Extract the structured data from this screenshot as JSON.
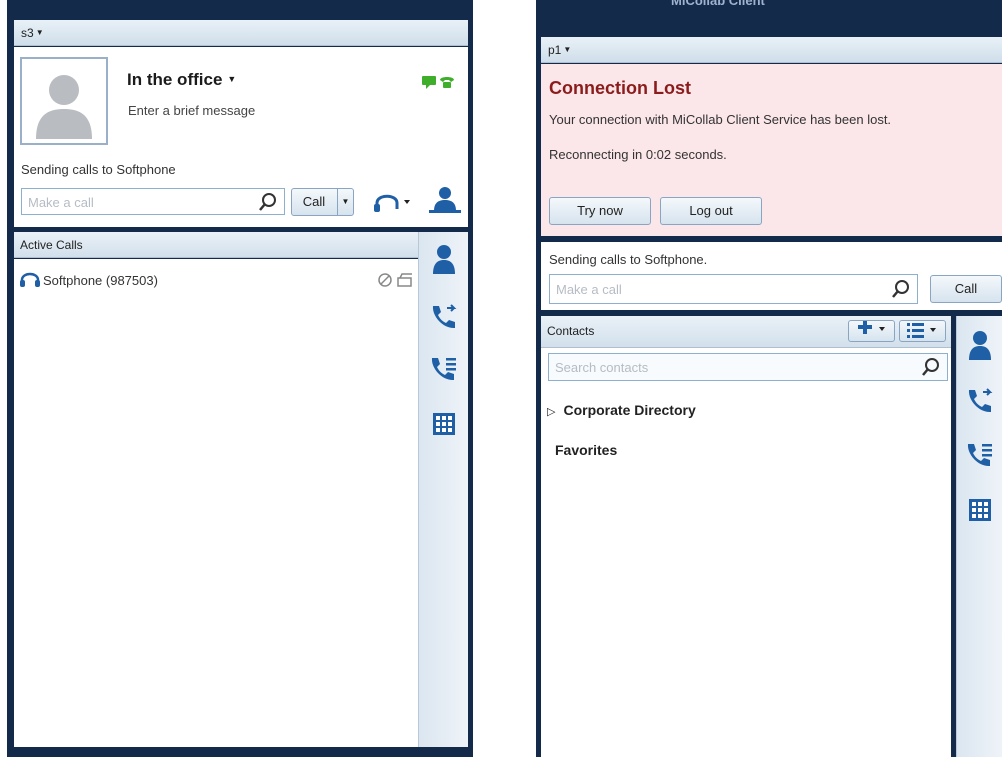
{
  "left_window": {
    "account_selector": "s3",
    "status": {
      "title": "In the office",
      "message_placeholder": "Enter a brief message"
    },
    "sending_calls": "Sending calls to Softphone",
    "make_call_placeholder": "Make a call",
    "call_button": "Call",
    "active_calls": {
      "header": "Active Calls",
      "items": [
        {
          "name": "Softphone (987503)"
        }
      ]
    },
    "rail_icons": [
      "person-icon",
      "call-transfer-icon",
      "call-history-icon",
      "dialpad-icon"
    ]
  },
  "right_window": {
    "title_fragment": "MiCollab Client",
    "account_selector": "p1",
    "error": {
      "title": "Connection Lost",
      "line1": "Your connection with MiCollab Client Service has been lost.",
      "line2": "Reconnecting in 0:02 seconds.",
      "try_now": "Try now",
      "log_out": "Log out"
    },
    "sending_calls": "Sending calls to Softphone.",
    "make_call_placeholder": "Make a call",
    "call_button": "Call",
    "contacts": {
      "header": "Contacts",
      "search_placeholder": "Search contacts",
      "items": [
        {
          "label": "Corporate Directory",
          "expandable": true
        },
        {
          "label": "Favorites",
          "expandable": false
        }
      ]
    }
  },
  "colors": {
    "window_frame": "#142a4a",
    "accent_blue": "#1f5fa6",
    "error_bg": "#fbe6e9",
    "error_title": "#8c1c1c",
    "presence_green": "#3fae2a"
  }
}
